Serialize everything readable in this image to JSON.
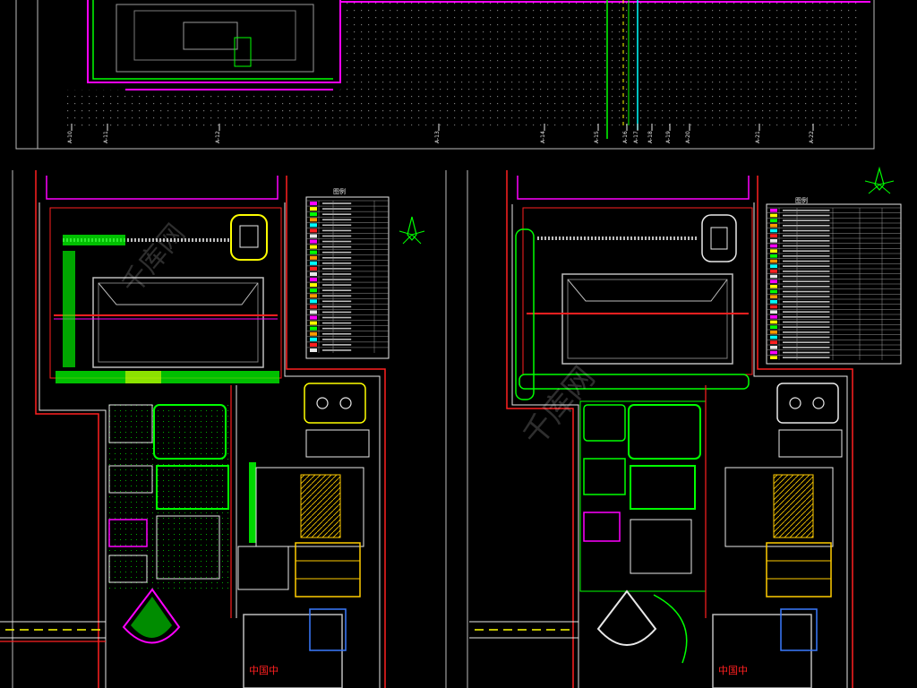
{
  "drawing": {
    "background": "#000000",
    "colors": {
      "magenta": "#ff00ff",
      "red": "#ff2020",
      "green": "#00ff00",
      "yellow": "#ffff00",
      "cyan": "#00ffff",
      "white": "#e8e8e8",
      "grey": "#8a8a8a",
      "orange": "#ff9900",
      "blue": "#3a7bff"
    },
    "top_sheet": {
      "axis_labels": [
        "A-10",
        "A-11",
        "A-12",
        "A-13",
        "A-14",
        "A-15",
        "A-16",
        "A-17",
        "A-18",
        "A-19",
        "A-20",
        "A-21",
        "A-22"
      ]
    },
    "left_plan": {
      "legend_title": "图例",
      "road_marking": "—— ——",
      "building_label": "中国中"
    },
    "right_plan": {
      "legend_title": "图例",
      "road_marking": "—— ——",
      "building_label": "中国中"
    },
    "watermark": "千库网"
  }
}
